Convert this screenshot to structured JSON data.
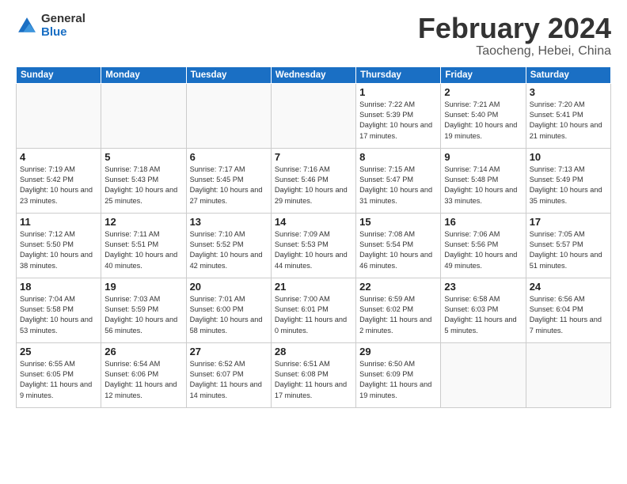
{
  "header": {
    "logo_general": "General",
    "logo_blue": "Blue",
    "month_title": "February 2024",
    "location": "Taocheng, Hebei, China"
  },
  "weekdays": [
    "Sunday",
    "Monday",
    "Tuesday",
    "Wednesday",
    "Thursday",
    "Friday",
    "Saturday"
  ],
  "weeks": [
    [
      {
        "day": "",
        "info": ""
      },
      {
        "day": "",
        "info": ""
      },
      {
        "day": "",
        "info": ""
      },
      {
        "day": "",
        "info": ""
      },
      {
        "day": "1",
        "info": "Sunrise: 7:22 AM\nSunset: 5:39 PM\nDaylight: 10 hours\nand 17 minutes."
      },
      {
        "day": "2",
        "info": "Sunrise: 7:21 AM\nSunset: 5:40 PM\nDaylight: 10 hours\nand 19 minutes."
      },
      {
        "day": "3",
        "info": "Sunrise: 7:20 AM\nSunset: 5:41 PM\nDaylight: 10 hours\nand 21 minutes."
      }
    ],
    [
      {
        "day": "4",
        "info": "Sunrise: 7:19 AM\nSunset: 5:42 PM\nDaylight: 10 hours\nand 23 minutes."
      },
      {
        "day": "5",
        "info": "Sunrise: 7:18 AM\nSunset: 5:43 PM\nDaylight: 10 hours\nand 25 minutes."
      },
      {
        "day": "6",
        "info": "Sunrise: 7:17 AM\nSunset: 5:45 PM\nDaylight: 10 hours\nand 27 minutes."
      },
      {
        "day": "7",
        "info": "Sunrise: 7:16 AM\nSunset: 5:46 PM\nDaylight: 10 hours\nand 29 minutes."
      },
      {
        "day": "8",
        "info": "Sunrise: 7:15 AM\nSunset: 5:47 PM\nDaylight: 10 hours\nand 31 minutes."
      },
      {
        "day": "9",
        "info": "Sunrise: 7:14 AM\nSunset: 5:48 PM\nDaylight: 10 hours\nand 33 minutes."
      },
      {
        "day": "10",
        "info": "Sunrise: 7:13 AM\nSunset: 5:49 PM\nDaylight: 10 hours\nand 35 minutes."
      }
    ],
    [
      {
        "day": "11",
        "info": "Sunrise: 7:12 AM\nSunset: 5:50 PM\nDaylight: 10 hours\nand 38 minutes."
      },
      {
        "day": "12",
        "info": "Sunrise: 7:11 AM\nSunset: 5:51 PM\nDaylight: 10 hours\nand 40 minutes."
      },
      {
        "day": "13",
        "info": "Sunrise: 7:10 AM\nSunset: 5:52 PM\nDaylight: 10 hours\nand 42 minutes."
      },
      {
        "day": "14",
        "info": "Sunrise: 7:09 AM\nSunset: 5:53 PM\nDaylight: 10 hours\nand 44 minutes."
      },
      {
        "day": "15",
        "info": "Sunrise: 7:08 AM\nSunset: 5:54 PM\nDaylight: 10 hours\nand 46 minutes."
      },
      {
        "day": "16",
        "info": "Sunrise: 7:06 AM\nSunset: 5:56 PM\nDaylight: 10 hours\nand 49 minutes."
      },
      {
        "day": "17",
        "info": "Sunrise: 7:05 AM\nSunset: 5:57 PM\nDaylight: 10 hours\nand 51 minutes."
      }
    ],
    [
      {
        "day": "18",
        "info": "Sunrise: 7:04 AM\nSunset: 5:58 PM\nDaylight: 10 hours\nand 53 minutes."
      },
      {
        "day": "19",
        "info": "Sunrise: 7:03 AM\nSunset: 5:59 PM\nDaylight: 10 hours\nand 56 minutes."
      },
      {
        "day": "20",
        "info": "Sunrise: 7:01 AM\nSunset: 6:00 PM\nDaylight: 10 hours\nand 58 minutes."
      },
      {
        "day": "21",
        "info": "Sunrise: 7:00 AM\nSunset: 6:01 PM\nDaylight: 11 hours\nand 0 minutes."
      },
      {
        "day": "22",
        "info": "Sunrise: 6:59 AM\nSunset: 6:02 PM\nDaylight: 11 hours\nand 2 minutes."
      },
      {
        "day": "23",
        "info": "Sunrise: 6:58 AM\nSunset: 6:03 PM\nDaylight: 11 hours\nand 5 minutes."
      },
      {
        "day": "24",
        "info": "Sunrise: 6:56 AM\nSunset: 6:04 PM\nDaylight: 11 hours\nand 7 minutes."
      }
    ],
    [
      {
        "day": "25",
        "info": "Sunrise: 6:55 AM\nSunset: 6:05 PM\nDaylight: 11 hours\nand 9 minutes."
      },
      {
        "day": "26",
        "info": "Sunrise: 6:54 AM\nSunset: 6:06 PM\nDaylight: 11 hours\nand 12 minutes."
      },
      {
        "day": "27",
        "info": "Sunrise: 6:52 AM\nSunset: 6:07 PM\nDaylight: 11 hours\nand 14 minutes."
      },
      {
        "day": "28",
        "info": "Sunrise: 6:51 AM\nSunset: 6:08 PM\nDaylight: 11 hours\nand 17 minutes."
      },
      {
        "day": "29",
        "info": "Sunrise: 6:50 AM\nSunset: 6:09 PM\nDaylight: 11 hours\nand 19 minutes."
      },
      {
        "day": "",
        "info": ""
      },
      {
        "day": "",
        "info": ""
      }
    ]
  ]
}
